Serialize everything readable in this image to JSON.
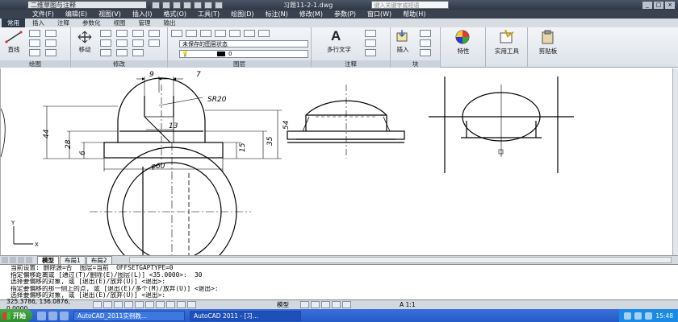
{
  "titlebar": {
    "workspace": "二维草图与注释",
    "document": "习题11-2-1.dwg",
    "search_placeholder": "键入关键字或短语"
  },
  "menu": [
    "文件(F)",
    "编辑(E)",
    "视图(V)",
    "插入(I)",
    "格式(O)",
    "工具(T)",
    "绘图(D)",
    "标注(N)",
    "修改(M)",
    "参数(P)",
    "窗口(W)",
    "帮助(H)"
  ],
  "ribbon_tabs": [
    "常用",
    "插入",
    "注释",
    "参数化",
    "视图",
    "管理",
    "输出"
  ],
  "ribbon": {
    "line_label": "直线",
    "move_label": "移动",
    "draw_panel": "绘图",
    "modify_panel": "修改",
    "layer_panel": "图层",
    "layer_state": "未保存的图层状态",
    "layer_current": "0",
    "mtext_label": "多行文字",
    "annotation_panel": "注释",
    "insert_label": "插入",
    "block_panel": "块",
    "properties_label": "特性",
    "utilities_label": "实用工具",
    "clipboard_label": "剪贴板"
  },
  "drawing": {
    "dim_9": "9",
    "dim_7": "7",
    "dim_sr20": "SR20",
    "dim_13": "13",
    "dim_44": "44",
    "dim_28": "28",
    "dim_6": "6",
    "dim_54": "54",
    "dim_35": "35",
    "dim_15": "15",
    "dim_phi60": "φ60",
    "axis_y": "Y",
    "axis_x": "X"
  },
  "layout_tabs": [
    "模型",
    "布局1",
    "布局2"
  ],
  "command_lines": [
    "当前设置: 删除源=否  图层=当前  OFFSETGAPTYPE=0",
    "指定偏移距离或 [通过(T)/删除(E)/图层(L)] <35.0000>:  30",
    "选择要偏移的对象, 或 [退出(E)/放弃(U)] <退出>:",
    "指定要偏移的那一侧上的点, 或 [退出(E)/多个(M)/放弃(U)] <退出>:",
    "选择要偏移的对象, 或 [退出(E)/放弃(U)] <退出>:"
  ],
  "status": {
    "coords": "325.3786, 136.0876, 0.0000",
    "model": "模型",
    "scale": "A 1:1"
  },
  "taskbar": {
    "start": "开始",
    "item1": "AutoCAD_2011实例教...",
    "item2": "AutoCAD 2011 - [习...",
    "clock": "15:48"
  }
}
